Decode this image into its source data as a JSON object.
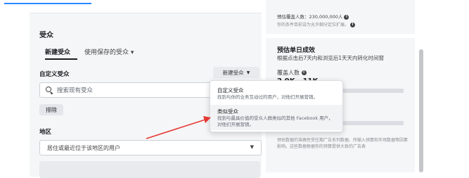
{
  "audience": {
    "section_title": "受众",
    "tabs": [
      {
        "label": "新建受众"
      },
      {
        "label": "使用保存的受众 ▾"
      }
    ],
    "custom_audience_label": "自定义受众",
    "create_button_label": "新建受众",
    "search_placeholder": "搜索现有受众",
    "exclude_label": "排除",
    "region_label": "地区",
    "region_value": "居住或最近位于该地区的用户"
  },
  "dropdown": {
    "items": [
      {
        "title": "自定义受众",
        "desc": "找到与你的业务互动过的用户，对他们开展营销。"
      },
      {
        "title": "类似受众",
        "desc": "找到与最具价值的受众人群类似的其他 Facebook 用户，对他们开展营销。"
      }
    ]
  },
  "estimate": {
    "reach_text": "预估覆盖人数：230,000,000人",
    "reach_note": "你的条件目前设为允许细分定位扩展。",
    "title": "预估单日成效",
    "subtitle": "根据点击后7天内和浏览后1天天内转化时间窗",
    "metric_label": "覆盖人数",
    "metric_value": "2.9K - 11K",
    "footer": "预估数据的准确性受往期广告系列数据、所输入预算和市场数据等因素影响。这些数据根据你的预算提供大致的广告表"
  },
  "colors": {
    "accent": "#2d88ff",
    "arrow": "#e53935"
  }
}
